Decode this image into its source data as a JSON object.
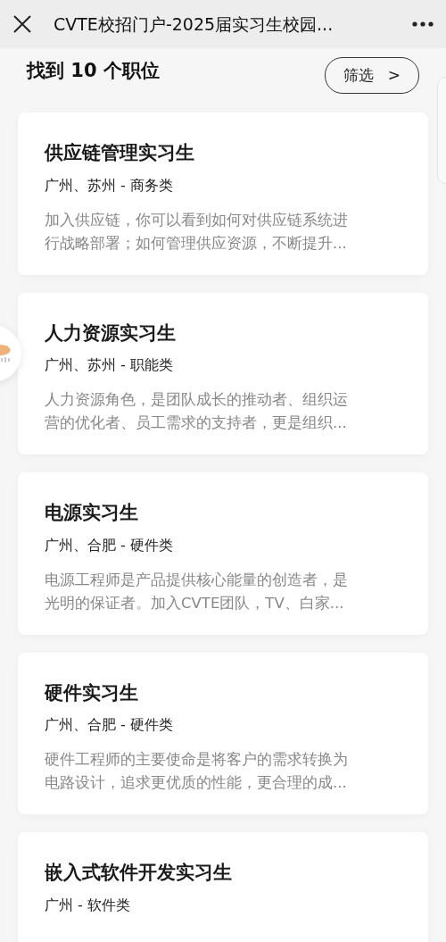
{
  "window": {
    "title": "CVTE校招门户-2025届实习生校园..."
  },
  "heading": "找到 10 个职位",
  "filter_button": {
    "label": "筛选",
    "icon": ">"
  },
  "jobs": [
    {
      "title": "供应链管理实习生",
      "location": "广州、苏州 - 商务类",
      "description": "加入供应链，你可以看到如何对供应链系统进行战略部署；如何管理供应资源，不断提升..."
    },
    {
      "title": "人力资源实习生",
      "location": "广州、苏州 - 职能类",
      "description": "人力资源角色，是团队成长的推动者、组织运营的优化者、员工需求的支持者，更是组织..."
    },
    {
      "title": "电源实习生",
      "location": "广州、合肥 - 硬件类",
      "description": "电源工程师是产品提供核心能量的创造者，是光明的保证者。加入CVTE团队，TV、白家..."
    },
    {
      "title": "硬件实习生",
      "location": "广州、合肥 - 硬件类",
      "description": "硬件工程师的主要使命是将客户的需求转换为电路设计，追求更优质的性能，更合理的成..."
    },
    {
      "title": "嵌入式软件开发实习生",
      "location": "广州 - 软件类"
    }
  ]
}
